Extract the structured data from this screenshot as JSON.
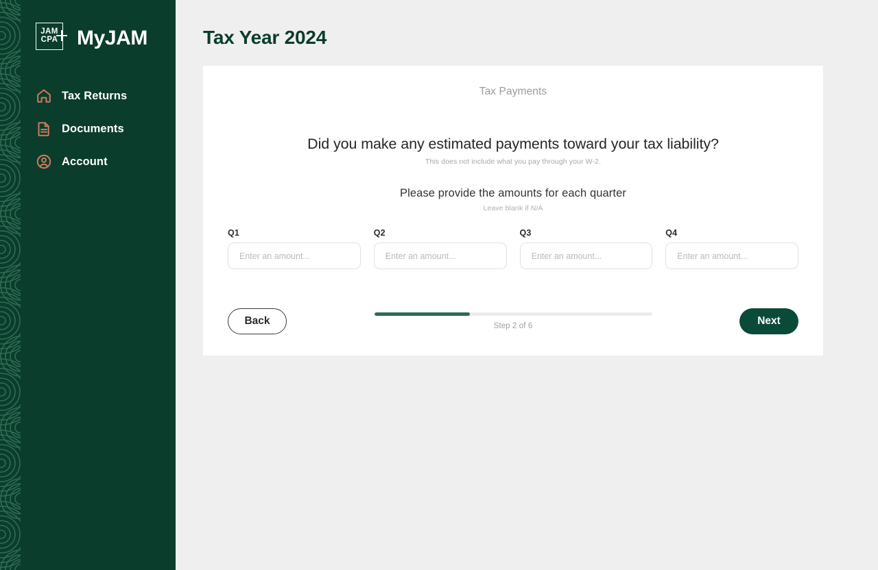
{
  "theme": {
    "sidebar_bg": "#0a3d2c",
    "page_bg": "#efefef",
    "card_bg": "#ffffff",
    "accent_green": "#0a4a38",
    "progress_green": "#2f6b54",
    "icon_coral": "#d4795e",
    "title_green": "#0a3d2c"
  },
  "sidebar": {
    "logo": {
      "line1": "JAM",
      "line2": "CPA",
      "plus": "+"
    },
    "brand_title": "MyJAM",
    "items": [
      {
        "label": "Tax Returns",
        "icon": "home-icon"
      },
      {
        "label": "Documents",
        "icon": "document-icon"
      },
      {
        "label": "Account",
        "icon": "account-icon"
      }
    ]
  },
  "header": {
    "page_title": "Tax Year 2024"
  },
  "card": {
    "eyebrow": "Tax Payments",
    "question": {
      "title": "Did you make any estimated payments toward your tax liability?",
      "subtitle": "This does not include what you pay through your W-2."
    },
    "prompt": {
      "title": "Please provide the amounts for each quarter",
      "subtitle": "Leave blank if N/A"
    },
    "quarters": [
      {
        "label": "Q1",
        "value": "",
        "placeholder": "Enter an amount..."
      },
      {
        "label": "Q2",
        "value": "",
        "placeholder": "Enter an amount..."
      },
      {
        "label": "Q3",
        "value": "",
        "placeholder": "Enter an amount..."
      },
      {
        "label": "Q4",
        "value": "",
        "placeholder": "Enter an amount..."
      }
    ],
    "footer": {
      "back_label": "Back",
      "next_label": "Next",
      "step_text": "Step 2 of 6",
      "progress_percent": 34.5
    }
  }
}
